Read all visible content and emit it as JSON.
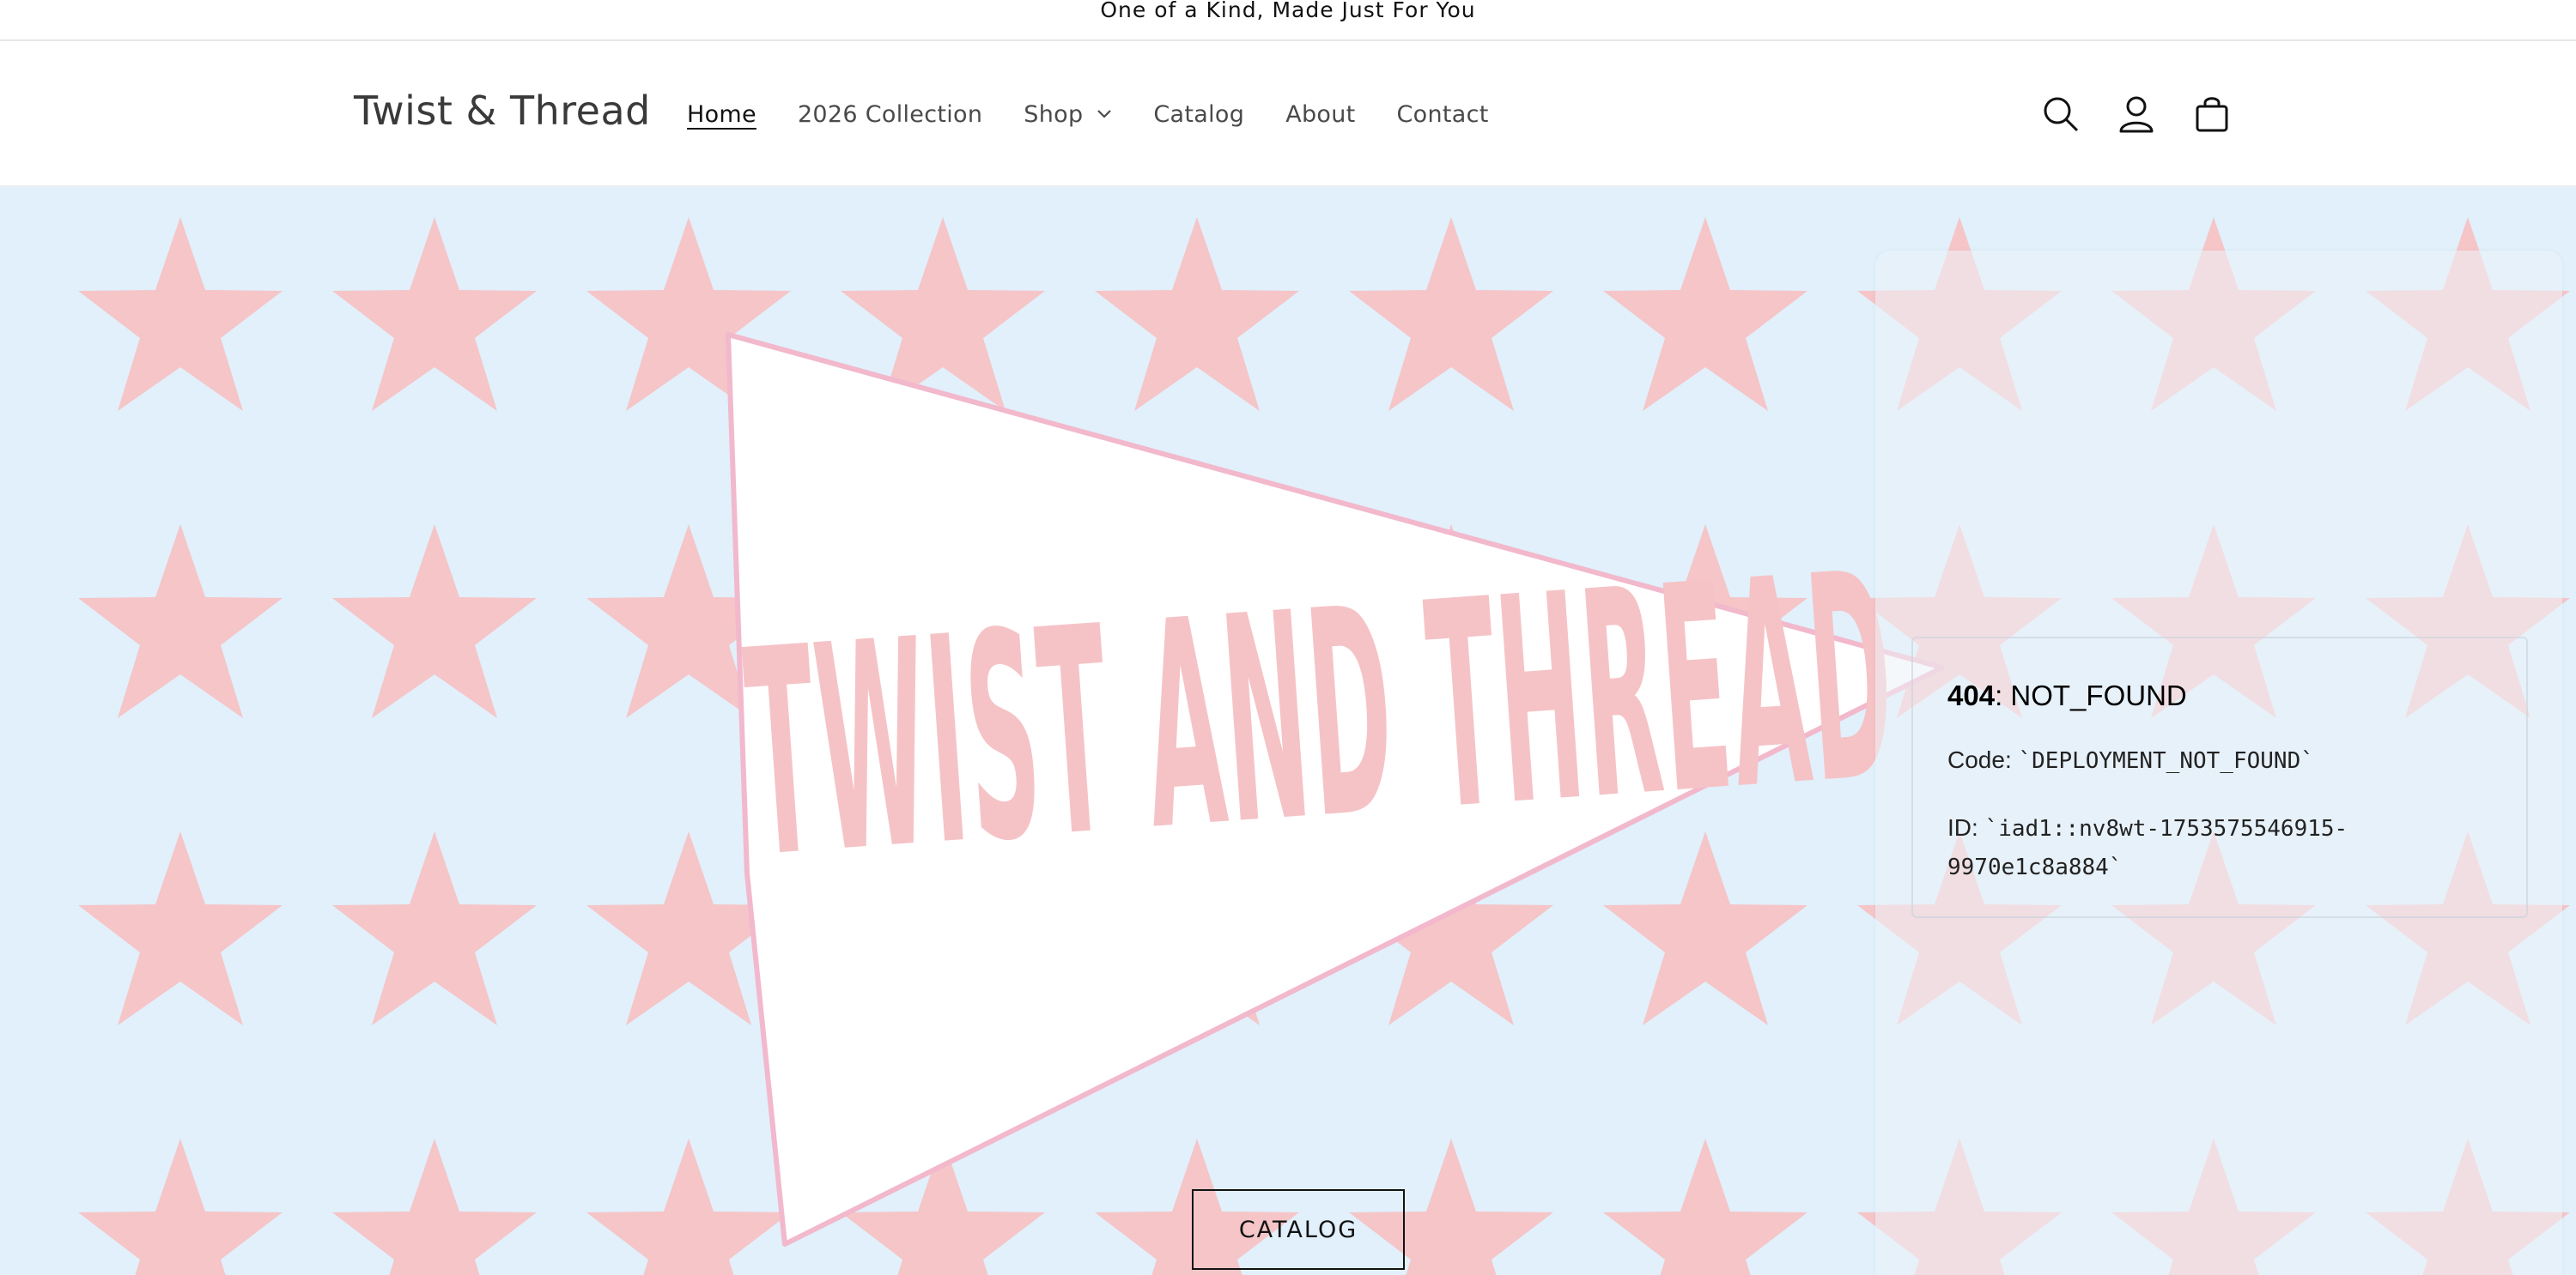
{
  "announcement": {
    "text": "One of a Kind, Made Just For You"
  },
  "header": {
    "logo": "Twist & Thread",
    "nav": [
      {
        "label": "Home",
        "active": true
      },
      {
        "label": "2026 Collection"
      },
      {
        "label": "Shop",
        "has_dropdown": true
      },
      {
        "label": "Catalog"
      },
      {
        "label": "About"
      },
      {
        "label": "Contact"
      }
    ],
    "icons": [
      "search-icon",
      "account-icon",
      "cart-icon"
    ]
  },
  "hero": {
    "pennant_text": "TWIST AND THREAD",
    "button_label": "CATALOG",
    "colors": {
      "background": "#e1f0fb",
      "stars": "#f5c5c8",
      "pennant_fill": "#ffffff",
      "pennant_border": "#f2b8cc"
    }
  },
  "error": {
    "status": "404",
    "status_text": ": NOT_FOUND",
    "code_label": "Code: ",
    "code_value": "`DEPLOYMENT_NOT_FOUND`",
    "id_label": "ID: ",
    "id_value_1": "`iad1::nv8wt-1753575546915-",
    "id_value_2": "9970e1c8a884`"
  }
}
